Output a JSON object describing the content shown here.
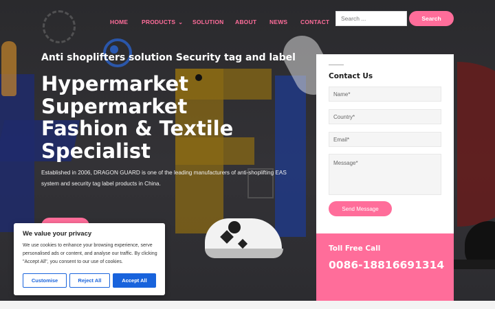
{
  "nav": {
    "items": [
      "HOME",
      "PRODUCTS",
      "SOLUTION",
      "ABOUT",
      "NEWS",
      "CONTACT"
    ],
    "products_icon": "chevron-down-icon"
  },
  "search": {
    "placeholder": "Search ...",
    "button_label": "Search"
  },
  "hero": {
    "subtitle": "Anti shoplifters solution Security tag and label",
    "headline": [
      "Hypermarket",
      "Supermarket",
      "Fashion & Textile",
      "Specialist"
    ],
    "description": "Established in 2006, DRAGON GUARD is one of the leading manufacturers of anti-shoplifting EAS system and security tag label products in China."
  },
  "contact": {
    "title": "Contact Us",
    "fields": {
      "name_placeholder": "Name*",
      "country_placeholder": "Country*",
      "email_placeholder": "Email*",
      "message_placeholder": "Message*"
    },
    "send_label": "Send Message"
  },
  "tollfree": {
    "label": "Toll Free Call",
    "phone": "0086-18816691314"
  },
  "cookie": {
    "title": "We value your privacy",
    "text": "We use cookies to enhance your browsing experience, serve personalised ads or content, and analyse our traffic. By clicking \"Accept All\", you consent to our use of cookies.",
    "customise_label": "Customise",
    "reject_label": "Reject All",
    "accept_label": "Accept All"
  },
  "colors": {
    "accent": "#ff6d9a",
    "cookie_blue": "#1863dc",
    "hero_bg": "#2f2f33"
  }
}
